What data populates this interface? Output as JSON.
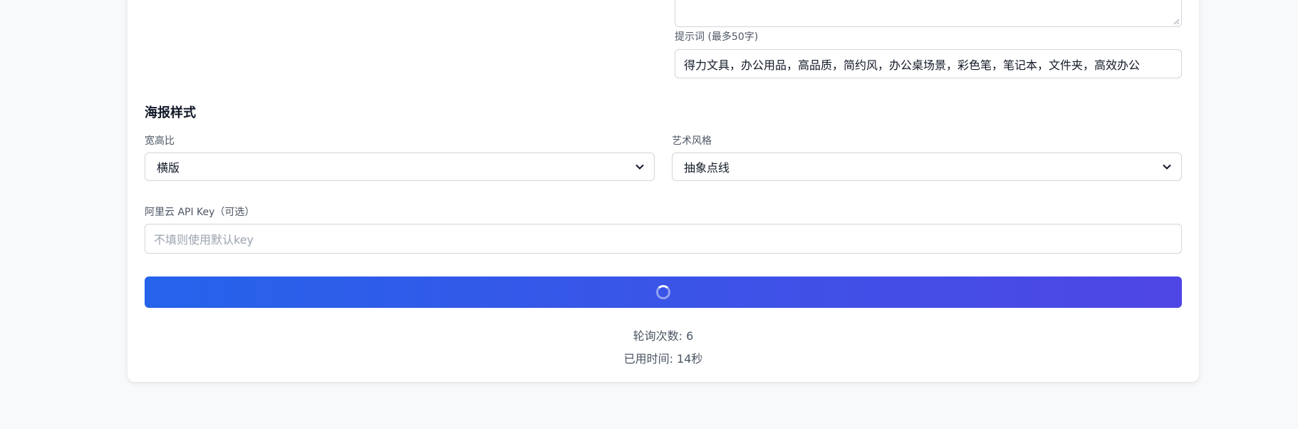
{
  "prompt": {
    "label": "提示词 (最多50字)",
    "value": "得力文具，办公用品，高品质，简约风，办公桌场景，彩色笔，笔记本，文件夹，高效办公"
  },
  "poster_style": {
    "title": "海报样式",
    "aspect_ratio": {
      "label": "宽高比",
      "selected": "横版"
    },
    "art_style": {
      "label": "艺术风格",
      "selected": "抽象点线"
    }
  },
  "api_key": {
    "label": "阿里云 API Key（可选）",
    "placeholder": "不填则使用默认key",
    "value": ""
  },
  "generate_button": {
    "state": "loading"
  },
  "status": {
    "poll_count": "轮询次数: 6",
    "elapsed": "已用时间: 14秒"
  },
  "colors": {
    "page_bg": "#f8f9fb",
    "button_gradient_start": "#2563eb",
    "button_gradient_end": "#4f46e5",
    "border": "#d1d5db"
  }
}
